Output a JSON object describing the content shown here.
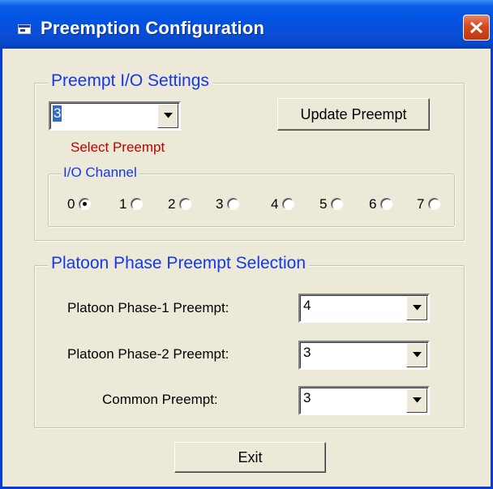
{
  "window": {
    "title": "Preemption Configuration",
    "title_color": "#0054e3",
    "close_color": "#d24a1c"
  },
  "io_settings": {
    "label": "Preempt I/O Settings",
    "select_preempt": {
      "value": "3"
    },
    "select_caption": "Select Preempt",
    "update_button": "Update Preempt",
    "io_channel": {
      "label": "I/O Channel",
      "options": [
        "0",
        "1",
        "2",
        "3",
        "4",
        "5",
        "6",
        "7"
      ],
      "selected": "0"
    }
  },
  "platoon": {
    "label": "Platoon Phase Preempt Selection",
    "rows": [
      {
        "label": "Platoon Phase-1 Preempt:",
        "value": "4"
      },
      {
        "label": "Platoon Phase-2 Preempt:",
        "value": "3"
      },
      {
        "label": "Common Preempt:",
        "value": "3"
      }
    ]
  },
  "exit_button": "Exit",
  "colors": {
    "group_label": "#1438e8",
    "caption_red": "#c00000",
    "face": "#ece9d8"
  }
}
